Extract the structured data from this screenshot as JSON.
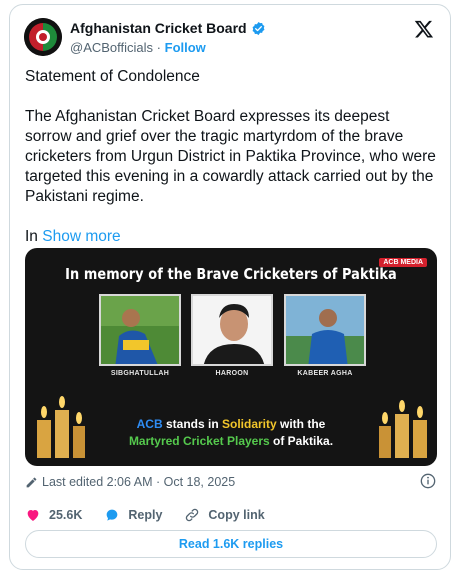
{
  "author": {
    "name": "Afghanistan Cricket Board",
    "handle": "@ACBofficials",
    "separator": "·",
    "follow_label": "Follow"
  },
  "post": {
    "heading": "Statement of Condolence",
    "paragraph": "The Afghanistan Cricket Board expresses its deepest sorrow and grief over the tragic martyrdom of the brave cricketers from Urgun District in Paktika Province, who were targeted this evening in a cowardly attack carried out by the Pakistani regime.",
    "truncated_start": "In",
    "show_more_label": "Show more"
  },
  "media": {
    "title": "In memory of the Brave Cricketers of Paktika",
    "badge": "ACB MEDIA",
    "players": [
      "SIBGHATULLAH",
      "HAROON",
      "KABEER AGHA"
    ],
    "solidarity": {
      "part1": "ACB",
      "part2": " stands in ",
      "part3": "Solidarity",
      "part4": " with the",
      "part5": "Martyred Cricket Players",
      "part6": " of Paktika."
    }
  },
  "meta": {
    "edited": "Last edited 2:06 AM · Oct 18, 2025"
  },
  "actions": {
    "likes": "25.6K",
    "reply_label": "Reply",
    "copy_link_label": "Copy link"
  },
  "replies_button": "Read 1.6K replies",
  "colors": {
    "accent": "#1d9bf0",
    "like": "#f91880",
    "text_secondary": "#536471"
  }
}
